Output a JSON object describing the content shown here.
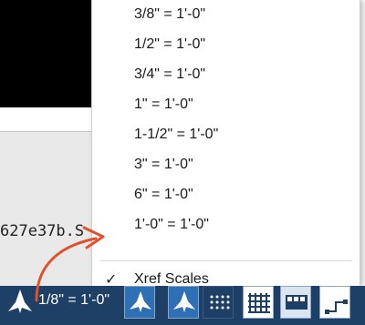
{
  "left_area": {
    "filename_fragment": "627e37b.S"
  },
  "scale_menu": {
    "items": [
      {
        "label": "3/8\" = 1'-0\""
      },
      {
        "label": "1/2\" = 1'-0\""
      },
      {
        "label": "3/4\" = 1'-0\""
      },
      {
        "label": "1\" = 1'-0\""
      },
      {
        "label": "1-1/2\" = 1'-0\""
      },
      {
        "label": "3\" = 1'-0\""
      },
      {
        "label": "6\" = 1'-0\""
      },
      {
        "label": "1'-0\" = 1'-0\""
      }
    ],
    "xref_item": {
      "label": "Xref Scales",
      "checked": true,
      "check_glyph": "✓"
    }
  },
  "status_bar": {
    "current_scale": "1/8\" = 1'-0\"",
    "buttons": [
      {
        "icon": "annotation-visibility-icon"
      },
      {
        "icon": "auto-scale-icon"
      },
      {
        "icon": "grid-dots-icon"
      },
      {
        "icon": "grid-icon"
      },
      {
        "icon": "toolbar-icon"
      },
      {
        "icon": "corner-icon"
      }
    ]
  },
  "colors": {
    "annotation_arrow": "#e0522e",
    "status_bar": "#1e3f66",
    "button_active": "#2f6fb5"
  }
}
